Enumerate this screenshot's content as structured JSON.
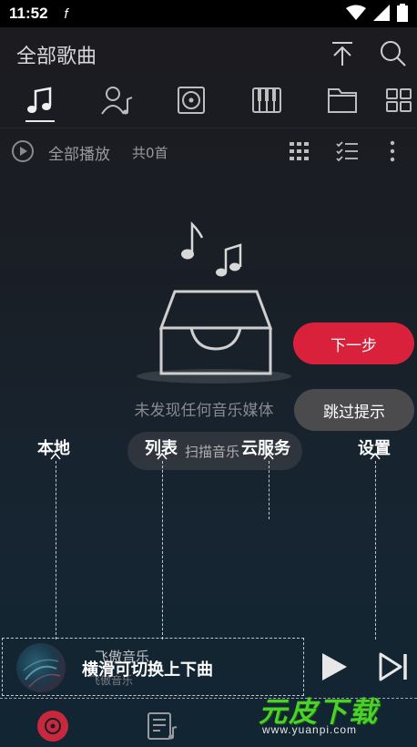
{
  "status_bar": {
    "time": "11:52",
    "notification_glyph": "f"
  },
  "header": {
    "title": "全部歌曲"
  },
  "tabs": [
    {
      "name": "local-songs",
      "icon": "music-note-icon"
    },
    {
      "name": "artists",
      "icon": "artist-icon"
    },
    {
      "name": "albums",
      "icon": "album-icon"
    },
    {
      "name": "genres",
      "icon": "piano-icon"
    },
    {
      "name": "folders",
      "icon": "folder-icon"
    },
    {
      "name": "more",
      "icon": "grid-icon"
    }
  ],
  "action_row": {
    "play_all_label": "全部播放",
    "count_label": "共0首"
  },
  "empty_state": {
    "message": "未发现任何音乐媒体",
    "scan_label": "扫描音乐"
  },
  "guide": {
    "next_label": "下一步",
    "skip_label": "跳过提示",
    "labels": [
      "本地",
      "列表",
      "云服务",
      "设置"
    ],
    "swipe_tip": "横滑可切换上下曲"
  },
  "mini_player": {
    "title": "飞傲音乐",
    "artist": "飞傲音乐"
  },
  "watermark": {
    "brand": "元皮下载",
    "url": "www.yuanpi.com"
  },
  "colors": {
    "accent": "#d9213b",
    "watermark": "#4cd02a"
  }
}
